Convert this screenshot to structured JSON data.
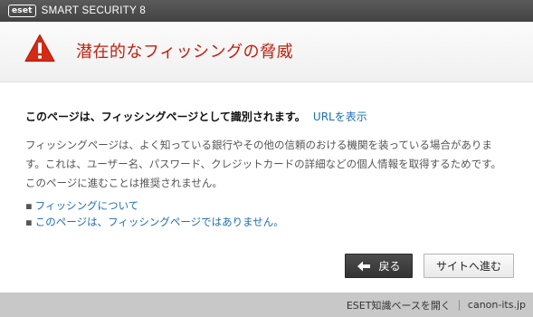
{
  "app": {
    "logo_text": "eset",
    "product_name": "SMART SECURITY 8"
  },
  "header": {
    "icon": "warning-triangle-icon",
    "title": "潜在的なフィッシングの脅威"
  },
  "message": {
    "headline": "このページは、フィッシングページとして識別されます。",
    "show_url_link": "URLを表示",
    "description": [
      "フィッシングページは、よく知っている銀行やその他の信頼のおける機関を装っている場合がありま",
      "す。これは、ユーザー名、パスワード、クレジットカードの詳細などの個人情報を取得するためです。",
      "このページに進むことは推奨されません。"
    ]
  },
  "links": [
    {
      "bullet": "▪",
      "label": "フィッシングについて"
    },
    {
      "bullet": "▪",
      "label": "このページは、フィッシングページではありません。"
    }
  ],
  "buttons": {
    "back_label": "戻る",
    "back_icon": "arrow-left-icon",
    "proceed_label": "サイトへ進む"
  },
  "footer": {
    "knowledgebase_link": "ESET知識ベースを開く",
    "site": "canon-its.jp"
  },
  "colors": {
    "title_red": "#c0210f",
    "link_blue": "#1d6fb0",
    "titlebar_gray": "#4a4a4a",
    "footer_gray": "#c8c8c8"
  }
}
